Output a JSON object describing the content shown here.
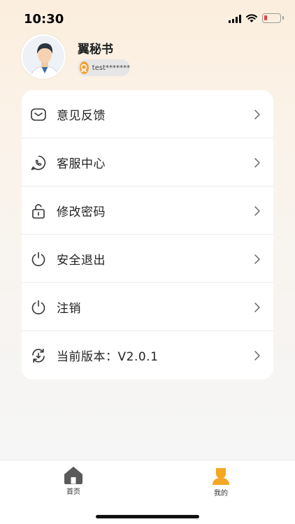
{
  "status_bar": {
    "time": "10:30"
  },
  "profile": {
    "name": "翼秘书",
    "account": "test*******"
  },
  "menu": [
    {
      "label": "意见反馈",
      "icon": "feedback-icon"
    },
    {
      "label": "客服中心",
      "icon": "customer-service-icon"
    },
    {
      "label": "修改密码",
      "icon": "lock-icon"
    },
    {
      "label": "安全退出",
      "icon": "power-icon"
    },
    {
      "label": "注销",
      "icon": "power-icon"
    },
    {
      "label": "当前版本：V2.0.1",
      "icon": "update-icon"
    }
  ],
  "tabbar": {
    "home_label": "首页",
    "mine_label": "我的"
  },
  "colors": {
    "accent": "#f0a23b",
    "text": "#222222",
    "tab_active": "#f5a623",
    "tab_inactive": "#5a5a5a"
  }
}
